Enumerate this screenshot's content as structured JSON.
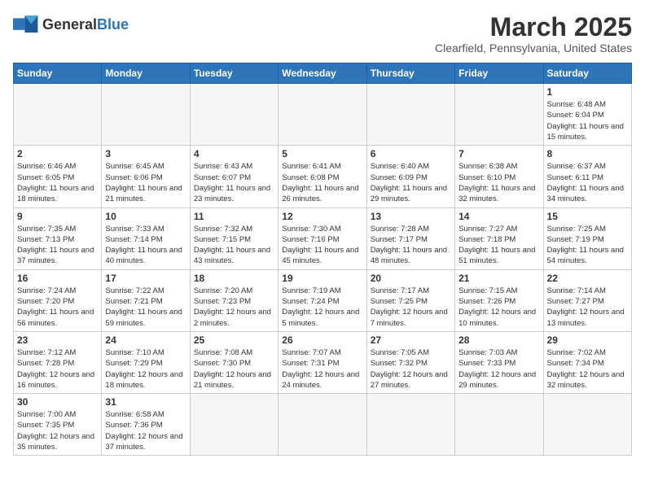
{
  "header": {
    "logo_general": "General",
    "logo_blue": "Blue",
    "month_title": "March 2025",
    "location": "Clearfield, Pennsylvania, United States"
  },
  "weekdays": [
    "Sunday",
    "Monday",
    "Tuesday",
    "Wednesday",
    "Thursday",
    "Friday",
    "Saturday"
  ],
  "weeks": [
    [
      {
        "day": "",
        "info": ""
      },
      {
        "day": "",
        "info": ""
      },
      {
        "day": "",
        "info": ""
      },
      {
        "day": "",
        "info": ""
      },
      {
        "day": "",
        "info": ""
      },
      {
        "day": "",
        "info": ""
      },
      {
        "day": "1",
        "info": "Sunrise: 6:48 AM\nSunset: 6:04 PM\nDaylight: 11 hours\nand 15 minutes."
      }
    ],
    [
      {
        "day": "2",
        "info": "Sunrise: 6:46 AM\nSunset: 6:05 PM\nDaylight: 11 hours\nand 18 minutes."
      },
      {
        "day": "3",
        "info": "Sunrise: 6:45 AM\nSunset: 6:06 PM\nDaylight: 11 hours\nand 21 minutes."
      },
      {
        "day": "4",
        "info": "Sunrise: 6:43 AM\nSunset: 6:07 PM\nDaylight: 11 hours\nand 23 minutes."
      },
      {
        "day": "5",
        "info": "Sunrise: 6:41 AM\nSunset: 6:08 PM\nDaylight: 11 hours\nand 26 minutes."
      },
      {
        "day": "6",
        "info": "Sunrise: 6:40 AM\nSunset: 6:09 PM\nDaylight: 11 hours\nand 29 minutes."
      },
      {
        "day": "7",
        "info": "Sunrise: 6:38 AM\nSunset: 6:10 PM\nDaylight: 11 hours\nand 32 minutes."
      },
      {
        "day": "8",
        "info": "Sunrise: 6:37 AM\nSunset: 6:11 PM\nDaylight: 11 hours\nand 34 minutes."
      }
    ],
    [
      {
        "day": "9",
        "info": "Sunrise: 7:35 AM\nSunset: 7:13 PM\nDaylight: 11 hours\nand 37 minutes."
      },
      {
        "day": "10",
        "info": "Sunrise: 7:33 AM\nSunset: 7:14 PM\nDaylight: 11 hours\nand 40 minutes."
      },
      {
        "day": "11",
        "info": "Sunrise: 7:32 AM\nSunset: 7:15 PM\nDaylight: 11 hours\nand 43 minutes."
      },
      {
        "day": "12",
        "info": "Sunrise: 7:30 AM\nSunset: 7:16 PM\nDaylight: 11 hours\nand 45 minutes."
      },
      {
        "day": "13",
        "info": "Sunrise: 7:28 AM\nSunset: 7:17 PM\nDaylight: 11 hours\nand 48 minutes."
      },
      {
        "day": "14",
        "info": "Sunrise: 7:27 AM\nSunset: 7:18 PM\nDaylight: 11 hours\nand 51 minutes."
      },
      {
        "day": "15",
        "info": "Sunrise: 7:25 AM\nSunset: 7:19 PM\nDaylight: 11 hours\nand 54 minutes."
      }
    ],
    [
      {
        "day": "16",
        "info": "Sunrise: 7:24 AM\nSunset: 7:20 PM\nDaylight: 11 hours\nand 56 minutes."
      },
      {
        "day": "17",
        "info": "Sunrise: 7:22 AM\nSunset: 7:21 PM\nDaylight: 11 hours\nand 59 minutes."
      },
      {
        "day": "18",
        "info": "Sunrise: 7:20 AM\nSunset: 7:23 PM\nDaylight: 12 hours\nand 2 minutes."
      },
      {
        "day": "19",
        "info": "Sunrise: 7:19 AM\nSunset: 7:24 PM\nDaylight: 12 hours\nand 5 minutes."
      },
      {
        "day": "20",
        "info": "Sunrise: 7:17 AM\nSunset: 7:25 PM\nDaylight: 12 hours\nand 7 minutes."
      },
      {
        "day": "21",
        "info": "Sunrise: 7:15 AM\nSunset: 7:26 PM\nDaylight: 12 hours\nand 10 minutes."
      },
      {
        "day": "22",
        "info": "Sunrise: 7:14 AM\nSunset: 7:27 PM\nDaylight: 12 hours\nand 13 minutes."
      }
    ],
    [
      {
        "day": "23",
        "info": "Sunrise: 7:12 AM\nSunset: 7:28 PM\nDaylight: 12 hours\nand 16 minutes."
      },
      {
        "day": "24",
        "info": "Sunrise: 7:10 AM\nSunset: 7:29 PM\nDaylight: 12 hours\nand 18 minutes."
      },
      {
        "day": "25",
        "info": "Sunrise: 7:08 AM\nSunset: 7:30 PM\nDaylight: 12 hours\nand 21 minutes."
      },
      {
        "day": "26",
        "info": "Sunrise: 7:07 AM\nSunset: 7:31 PM\nDaylight: 12 hours\nand 24 minutes."
      },
      {
        "day": "27",
        "info": "Sunrise: 7:05 AM\nSunset: 7:32 PM\nDaylight: 12 hours\nand 27 minutes."
      },
      {
        "day": "28",
        "info": "Sunrise: 7:03 AM\nSunset: 7:33 PM\nDaylight: 12 hours\nand 29 minutes."
      },
      {
        "day": "29",
        "info": "Sunrise: 7:02 AM\nSunset: 7:34 PM\nDaylight: 12 hours\nand 32 minutes."
      }
    ],
    [
      {
        "day": "30",
        "info": "Sunrise: 7:00 AM\nSunset: 7:35 PM\nDaylight: 12 hours\nand 35 minutes."
      },
      {
        "day": "31",
        "info": "Sunrise: 6:58 AM\nSunset: 7:36 PM\nDaylight: 12 hours\nand 37 minutes."
      },
      {
        "day": "",
        "info": ""
      },
      {
        "day": "",
        "info": ""
      },
      {
        "day": "",
        "info": ""
      },
      {
        "day": "",
        "info": ""
      },
      {
        "day": "",
        "info": ""
      }
    ]
  ]
}
